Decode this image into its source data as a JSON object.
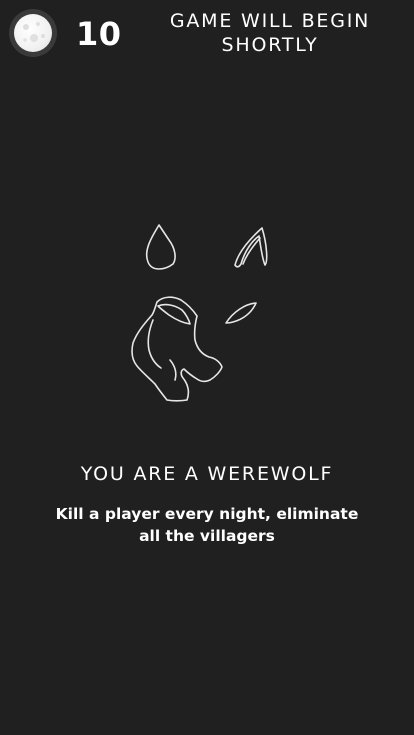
{
  "header": {
    "phase_icon": "full-moon-icon",
    "countdown": "10",
    "status": "GAME WILL BEGIN SHORTLY"
  },
  "role": {
    "icon": "werewolf-icon",
    "title": "YOU ARE A WEREWOLF",
    "description": "Kill a player every night, eliminate all the villagers"
  },
  "colors": {
    "background": "#202020",
    "text": "#ffffff",
    "icon_stroke": "#e6e6e6"
  }
}
